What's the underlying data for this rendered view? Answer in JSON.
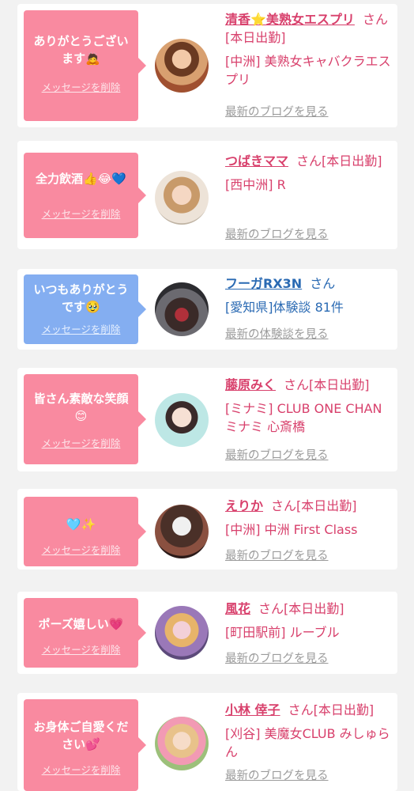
{
  "delete_label": "メッセージを削除",
  "colors": {
    "page_bg": "#f2f2f2",
    "pink_bubble": "#f98aa0",
    "blue_bubble": "#84aef1",
    "name_pink": "#d8406c",
    "name_blue": "#2a6ab3",
    "link_gray": "#9b9b9b"
  },
  "items": [
    {
      "bubble_color": "pink",
      "message_lines": [
        "ありがとうござい",
        "ます🙇"
      ],
      "name": "清香⭐美熟女エスプリ",
      "suffix": "さん[本日出勤]",
      "shop": "[中洲] 美熟女キャバクラエスプリ",
      "blog_link": "最新のブログを見る",
      "avatar_icon": "woman-portrait-avatar"
    },
    {
      "bubble_color": "pink",
      "message_lines": [
        "全力飲酒👍😂💙"
      ],
      "name": "つばきママ",
      "suffix": "さん[本日出勤]",
      "shop": "[西中洲] R",
      "blog_link": "最新のブログを見る",
      "avatar_icon": "woman-portrait-avatar"
    },
    {
      "bubble_color": "blue",
      "message_lines": [
        "いつもありがとう",
        "です🥹"
      ],
      "name": "フーガRX3N",
      "suffix": "さん",
      "shop": "[愛知県]体験談 81件",
      "blog_link": "最新の体験談を見る",
      "avatar_icon": "user-photo-avatar"
    },
    {
      "bubble_color": "pink",
      "message_lines": [
        "皆さん素敵な笑顔",
        "😊"
      ],
      "name": "藤原みく",
      "suffix": "さん[本日出勤]",
      "shop": "[ミナミ] CLUB ONE CHAN ミナミ 心斎橋",
      "blog_link": "最新のブログを見る",
      "avatar_icon": "woman-portrait-avatar"
    },
    {
      "bubble_color": "pink",
      "message_lines": [
        "🩵✨"
      ],
      "name": "えりか",
      "suffix": "さん[本日出勤]",
      "shop": "[中洲] 中洲 First Class",
      "blog_link": "最新のブログを見る",
      "avatar_icon": "woman-portrait-avatar"
    },
    {
      "bubble_color": "pink",
      "message_lines": [
        "ポーズ嬉しい💗"
      ],
      "name": "風花",
      "suffix": "さん[本日出勤]",
      "shop": "[町田駅前] ルーブル",
      "blog_link": "最新のブログを見る",
      "avatar_icon": "woman-portrait-avatar"
    },
    {
      "bubble_color": "pink",
      "message_lines": [
        "お身体ご自愛くだ",
        "さい💕"
      ],
      "name": "小林 倖子",
      "suffix": "さん[本日出勤]",
      "shop": "[刈谷] 美魔女CLUB みしゅらん",
      "blog_link": "最新のブログを見る",
      "avatar_icon": "woman-portrait-avatar"
    }
  ]
}
